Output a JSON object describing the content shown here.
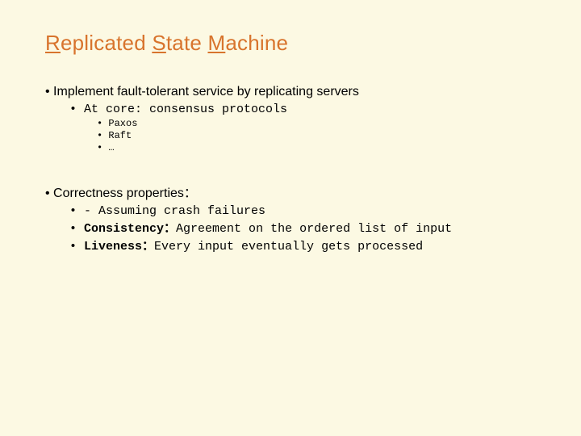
{
  "title": {
    "w1_first": "R",
    "w1_rest": "eplicated",
    "w2_first": "S",
    "w2_rest": "tate",
    "w3_first": "M",
    "w3_rest": "achine"
  },
  "l1a": "Implement fault-tolerant service by replicating servers",
  "l2a": "At core: consensus protocols",
  "l3a": "Paxos",
  "l3b": "Raft",
  "l3c": "…",
  "l1b": "Correctness properties：",
  "l2b1": "- Assuming crash failures",
  "l2b2_label": "Consistency：",
  "l2b2_text": "Agreement on the ordered list of input",
  "l2b3_label": "Liveness：",
  "l2b3_text": "Every input eventually gets processed"
}
